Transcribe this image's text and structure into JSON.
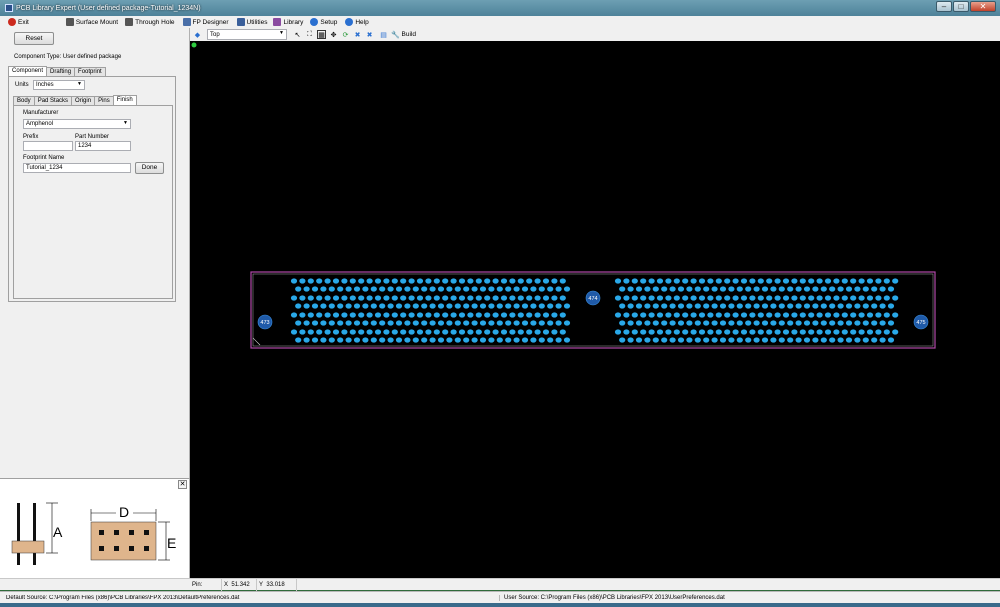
{
  "window": {
    "title": "PCB Library Expert (User defined package-Tutorial_1234N)",
    "minimize": "–",
    "maximize": "□",
    "close": "✕"
  },
  "menu": [
    {
      "label": "Exit",
      "icon": "exit-icon",
      "color": "#cc2a1e"
    },
    {
      "label": "Surface Mount",
      "icon": "surface-mount-icon",
      "color": "#444444"
    },
    {
      "label": "Through Hole",
      "icon": "through-hole-icon",
      "color": "#444444"
    },
    {
      "label": "FP Designer",
      "icon": "fp-designer-icon",
      "color": "#4a6fa8"
    },
    {
      "label": "Utilities",
      "icon": "utilities-icon",
      "color": "#3a5f9a"
    },
    {
      "label": "Library",
      "icon": "library-icon",
      "color": "#8a4aa0"
    },
    {
      "label": "Setup",
      "icon": "setup-icon",
      "color": "#2a6fd0"
    },
    {
      "label": "Help",
      "icon": "help-icon",
      "color": "#2a6fd0"
    }
  ],
  "left": {
    "reset_label": "Reset",
    "component_type": "Component Type: User defined package",
    "main_tabs": [
      "Component",
      "Drafting",
      "Footprint"
    ],
    "units_label": "Units",
    "units_value": "Inches",
    "sub_tabs": [
      "Body",
      "Pad Stacks",
      "Origin",
      "Pins",
      "Finish"
    ],
    "manufacturer_label": "Manufacturer",
    "manufacturer_value": "Amphenol",
    "prefix_label": "Prefix",
    "prefix_value": "",
    "part_number_label": "Part Number",
    "part_number_value": "1234",
    "footprint_name_label": "Footprint Name",
    "footprint_name_value": "Tutorial_1234",
    "done_label": "Done"
  },
  "preview": {
    "dim_a": "A",
    "dim_d": "D",
    "dim_e": "E",
    "close": "✕"
  },
  "toolbar": {
    "layer": "Top",
    "build_label": "Build"
  },
  "canvas": {
    "pad_color": "#29a8e8",
    "outline_color": "#b04aa8",
    "mount_pads": [
      "473",
      "474",
      "475"
    ]
  },
  "coords": {
    "pin_label": "Pin:",
    "x_label": "X",
    "x_value": "51.342",
    "y_label": "Y",
    "y_value": "33.018"
  },
  "status": {
    "default_source": "Default Source:  C:\\Program Files (x86)\\PCB Libraries\\FPX 2013\\DefaultPreferences.dat",
    "user_source": "User Source:  C:\\Program Files (x86)\\PCB Libraries\\FPX 2013\\UserPreferences.dat"
  }
}
